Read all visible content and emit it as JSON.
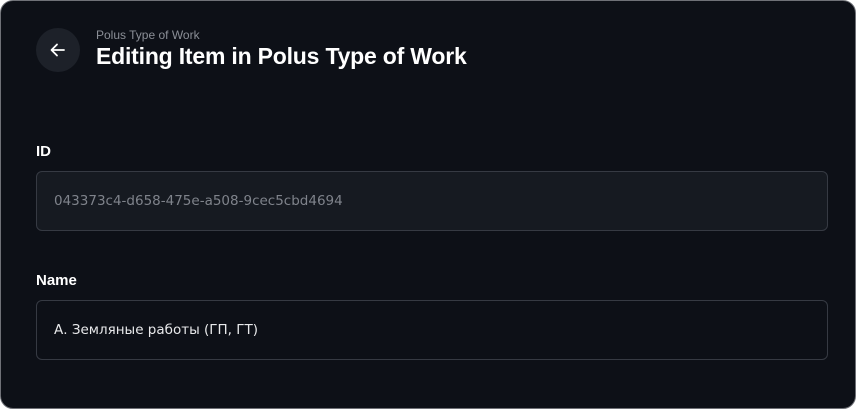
{
  "header": {
    "breadcrumb": "Polus Type of Work",
    "title": "Editing Item in Polus Type of Work",
    "back_icon": "arrow-left-icon"
  },
  "form": {
    "id_field": {
      "label": "ID",
      "value": "043373c4-d658-475e-a508-9cec5cbd4694"
    },
    "name_field": {
      "label": "Name",
      "value": "А. Земляные работы (ГП, ГТ)"
    }
  },
  "colors": {
    "background": "#0d1017",
    "readonly_field_bg": "#161a21",
    "field_border": "#363a43",
    "back_button_bg": "#1d2129"
  }
}
